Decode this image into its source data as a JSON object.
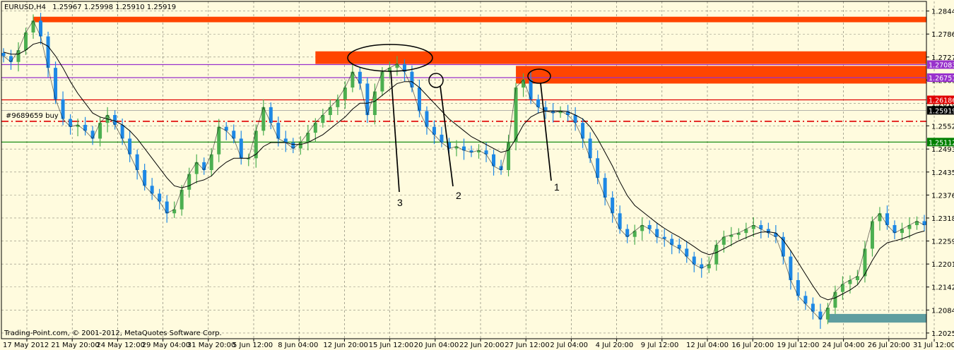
{
  "header": {
    "symbol": "EURUSD,H4",
    "ohlc": "1.25967 1.25998 1.25910 1.25919"
  },
  "footer": {
    "copyright": "Trading-Point.com, © 2001-2012, MetaQuotes Software Corp."
  },
  "order_label": "#9689659 buy",
  "annotations": [
    "1",
    "2",
    "3"
  ],
  "colors": {
    "background": "#FFFBDE",
    "zone_red": "#FF4500",
    "zone_teal": "#5F9EA0",
    "bull": "#4CAF50",
    "bear": "#1E88E5",
    "purple_line": "#9932CC",
    "red_line": "#E00000",
    "green_line": "#008000",
    "ma": "#000000"
  },
  "chart_data": {
    "type": "line",
    "title": "EURUSD,H4",
    "x_ticks": [
      "17 May 2012",
      "21 May 20:00",
      "24 May 12:00",
      "29 May 04:00",
      "31 May 20:00",
      "5 Jun 12:00",
      "8 Jun 04:00",
      "12 Jun 20:00",
      "15 Jun 12:00",
      "20 Jun 04:00",
      "22 Jun 20:00",
      "27 Jun 12:00",
      "2 Jul 04:00",
      "4 Jul 20:00",
      "9 Jul 12:00",
      "12 Jul 04:00",
      "16 Jul 20:00",
      "19 Jul 12:00",
      "24 Jul 04:00",
      "26 Jul 20:00",
      "31 Jul 12:00"
    ],
    "y_ticks": [
      1.28445,
      1.2786,
      1.27275,
      1.2669,
      1.261,
      1.25525,
      1.24935,
      1.2435,
      1.23765,
      1.2318,
      1.22595,
      1.2201,
      1.21425,
      1.2084,
      1.20255
    ],
    "ylim": [
      1.2011,
      1.2869
    ],
    "series": [
      {
        "values": [
          1.273,
          1.2715,
          1.2745,
          1.279,
          1.282,
          1.278,
          1.27,
          1.262,
          1.257,
          1.255,
          1.2555,
          1.254,
          1.252,
          1.256,
          1.258,
          1.2555,
          1.252,
          1.248,
          1.244,
          1.24,
          1.238,
          1.236,
          1.233,
          1.234,
          1.239,
          1.243,
          1.246,
          1.244,
          1.248,
          1.255,
          1.254,
          1.252,
          1.247,
          1.247,
          1.254,
          1.26,
          1.256,
          1.252,
          1.251,
          1.2495,
          1.251,
          1.2535,
          1.256,
          1.258,
          1.26,
          1.262,
          1.265,
          1.269,
          1.266,
          1.258,
          1.264,
          1.269,
          1.27,
          1.271,
          1.269,
          1.265,
          1.259,
          1.255,
          1.253,
          1.251,
          1.2495,
          1.25,
          1.249,
          1.2485,
          1.249,
          1.248,
          1.245,
          1.244,
          1.251,
          1.265,
          1.267,
          1.262,
          1.26,
          1.259,
          1.2585,
          1.259,
          1.258,
          1.256,
          1.252,
          1.247,
          1.242,
          1.237,
          1.233,
          1.229,
          1.227,
          1.2285,
          1.23,
          1.229,
          1.227,
          1.2265,
          1.225,
          1.224,
          1.222,
          1.22,
          1.219,
          1.22,
          1.225,
          1.227,
          1.2275,
          1.228,
          1.229,
          1.23,
          1.229,
          1.228,
          1.227,
          1.222,
          1.216,
          1.212,
          1.21,
          1.208,
          1.206,
          1.209,
          1.213,
          1.215,
          1.216,
          1.217,
          1.224,
          1.231,
          1.233,
          1.23,
          1.228,
          1.229,
          1.23,
          1.231,
          1.23
        ]
      },
      {
        "values": [
          1.274,
          1.2735,
          1.2735,
          1.2745,
          1.276,
          1.2765,
          1.2755,
          1.273,
          1.27,
          1.2665,
          1.2635,
          1.261,
          1.2585,
          1.2575,
          1.257,
          1.2565,
          1.2555,
          1.254,
          1.252,
          1.2495,
          1.247,
          1.2445,
          1.242,
          1.24,
          1.2395,
          1.24,
          1.241,
          1.2415,
          1.2425,
          1.2445,
          1.246,
          1.247,
          1.247,
          1.247,
          1.248,
          1.25,
          1.251,
          1.251,
          1.251,
          1.2505,
          1.2505,
          1.251,
          1.252,
          1.253,
          1.2545,
          1.256,
          1.2575,
          1.2595,
          1.261,
          1.261,
          1.2615,
          1.263,
          1.2645,
          1.266,
          1.2665,
          1.2665,
          1.265,
          1.263,
          1.261,
          1.259,
          1.257,
          1.2555,
          1.254,
          1.2525,
          1.2515,
          1.2505,
          1.2495,
          1.2485,
          1.249,
          1.252,
          1.2555,
          1.2575,
          1.2585,
          1.259,
          1.259,
          1.259,
          1.2588,
          1.258,
          1.257,
          1.255,
          1.252,
          1.2485,
          1.245,
          1.241,
          1.2375,
          1.235,
          1.2335,
          1.232,
          1.2305,
          1.2292,
          1.228,
          1.227,
          1.2258,
          1.2245,
          1.2232,
          1.2225,
          1.223,
          1.224,
          1.225,
          1.226,
          1.2268,
          1.2276,
          1.2282,
          1.2283,
          1.228,
          1.2262,
          1.2235,
          1.2205,
          1.2175,
          1.2145,
          1.2118,
          1.211,
          1.2115,
          1.2125,
          1.2135,
          1.2148,
          1.2175,
          1.221,
          1.224,
          1.2255,
          1.226,
          1.2265,
          1.2272,
          1.228,
          1.2285
        ]
      }
    ],
    "horizontal_lines": [
      {
        "value": 1.27083,
        "label": "1.27083",
        "kind": "purple"
      },
      {
        "value": 1.26751,
        "label": "1.26751",
        "kind": "purple"
      },
      {
        "value": 1.26186,
        "label": "1.26186",
        "kind": "red"
      },
      {
        "value": 1.25919,
        "label": "1.25919",
        "kind": "price"
      },
      {
        "value": 1.2564,
        "label": "",
        "kind": "order"
      },
      {
        "value": 1.25112,
        "label": "1.25112",
        "kind": "green"
      }
    ],
    "zones": [
      {
        "y1": 1.283,
        "y2": 1.2816,
        "kind": "red",
        "from_index": 4
      },
      {
        "y1": 1.2742,
        "y2": 1.271,
        "kind": "red",
        "from_index": 42
      },
      {
        "y1": 1.2705,
        "y2": 1.266,
        "kind": "red",
        "from_index": 69
      },
      {
        "y1": 1.2074,
        "y2": 1.2052,
        "kind": "teal",
        "from_index": 111
      }
    ]
  }
}
